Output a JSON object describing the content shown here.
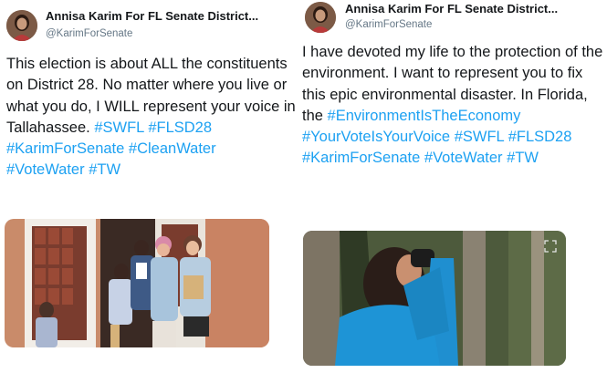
{
  "tweets": [
    {
      "author_name": "Annisa Karim For FL Senate District...",
      "handle": "@KarimForSenate",
      "text_parts": [
        {
          "t": "This election is about ALL the constituents on District 28.  No matter where you live or what you do, I WILL represent your voice in Tallahassee. ",
          "tag": false
        },
        {
          "t": "#SWFL",
          "tag": true
        },
        {
          "t": " ",
          "tag": false
        },
        {
          "t": "#FLSD28",
          "tag": true
        },
        {
          "t": " ",
          "tag": false
        },
        {
          "t": "#KarimForSenate",
          "tag": true
        },
        {
          "t": " ",
          "tag": false
        },
        {
          "t": "#CleanWater",
          "tag": true
        },
        {
          "t": " ",
          "tag": false
        },
        {
          "t": "#VoteWater",
          "tag": true
        },
        {
          "t": " ",
          "tag": false
        },
        {
          "t": "#TW",
          "tag": true
        }
      ],
      "media": "photo-group-at-door"
    },
    {
      "author_name": "Annisa Karim For FL Senate District...",
      "handle": "@KarimForSenate",
      "text_parts": [
        {
          "t": "I have devoted my life to the protection of the environment.  I want to represent you to fix this epic environmental disaster.  In Florida, the ",
          "tag": false
        },
        {
          "t": "#EnvironmentIsTheEconomy",
          "tag": true
        },
        {
          "t": " ",
          "tag": false
        },
        {
          "t": "#YourVoteIsYourVoice",
          "tag": true
        },
        {
          "t": " ",
          "tag": false
        },
        {
          "t": "#SWFL",
          "tag": true
        },
        {
          "t": " ",
          "tag": false
        },
        {
          "t": "#FLSD28",
          "tag": true
        },
        {
          "t": " ",
          "tag": false
        },
        {
          "t": "#KarimForSenate",
          "tag": true
        },
        {
          "t": " ",
          "tag": false
        },
        {
          "t": "#VoteWater",
          "tag": true
        },
        {
          "t": " ",
          "tag": false
        },
        {
          "t": "#TW",
          "tag": true
        }
      ],
      "media": "photo-woman-binoculars"
    }
  ],
  "colors": {
    "hashtag": "#1da1f2",
    "handle": "#657786",
    "text": "#14171a"
  }
}
